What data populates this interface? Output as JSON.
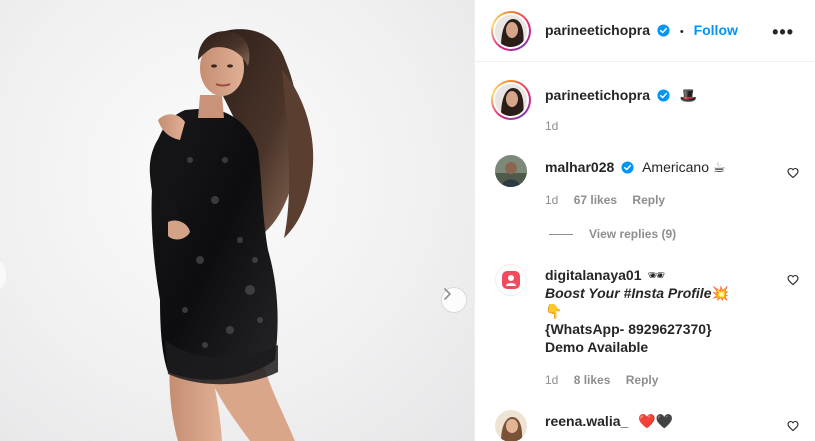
{
  "post": {
    "author": "parineetichopra",
    "follow_label": "Follow",
    "dot": "•",
    "more_label": "•••",
    "caption_emoji": "🎩",
    "caption_time": "1d"
  },
  "comments": [
    {
      "username": "malhar028",
      "verified": true,
      "text": "Americano ☕",
      "time": "1d",
      "likes": "67 likes",
      "reply": "Reply",
      "view_replies": "View replies (9)"
    },
    {
      "username": "digitalanaya01",
      "user_emoji": "🕶",
      "line1": "Boost Your #Insta Profile",
      "line1_emoji": "💥",
      "line2_emoji": "👇",
      "line3": "{WhatsApp- 8929627370}",
      "line4": "Demo Available",
      "time": "1d",
      "likes": "8 likes",
      "reply": "Reply"
    },
    {
      "username": "reena.walia_",
      "text": "❤️🖤"
    }
  ]
}
